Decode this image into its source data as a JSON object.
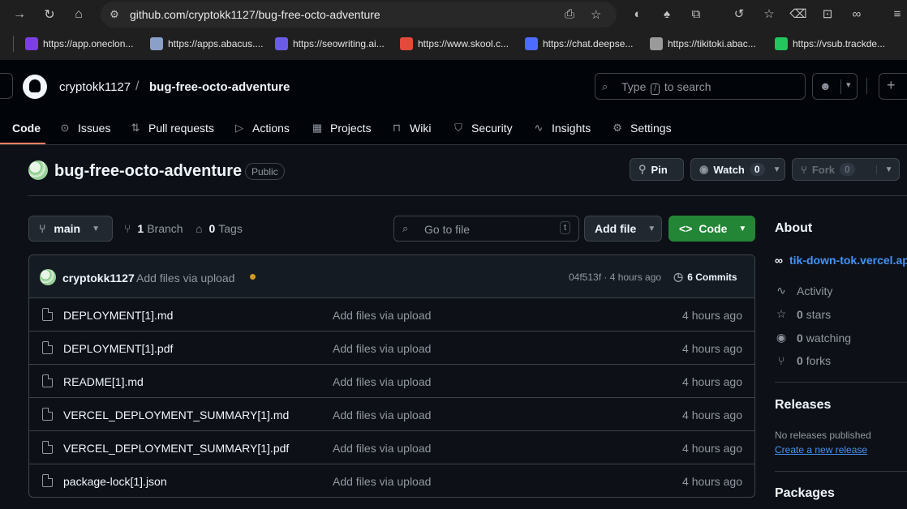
{
  "browser": {
    "url": "github.com/cryptokk1127/bug-free-octo-adventure",
    "bookmarks": [
      {
        "label": "https://app.oneclon...",
        "color": "#7b3fe4"
      },
      {
        "label": "https://apps.abacus....",
        "color": "#8aa0c8"
      },
      {
        "label": "https://seowriting.ai...",
        "color": "#6b5ce7"
      },
      {
        "label": "https://www.skool.c...",
        "color": "#e34a3c"
      },
      {
        "label": "https://chat.deepse...",
        "color": "#4d6bfe"
      },
      {
        "label": "https://tikitoki.abac...",
        "color": "#9a9a9a"
      },
      {
        "label": "https://vsub.trackde...",
        "color": "#22c55e"
      }
    ]
  },
  "header": {
    "owner": "cryptokk1127",
    "separator": "/",
    "repo": "bug-free-octo-adventure",
    "search_before": "Type",
    "search_key": "/",
    "search_after": "to search"
  },
  "tabs": [
    {
      "label": "Code",
      "icon": "code-icon",
      "glyph": "<>"
    },
    {
      "label": "Issues",
      "icon": "issue-icon",
      "glyph": "⊙"
    },
    {
      "label": "Pull requests",
      "icon": "pull-request-icon",
      "glyph": "⇅"
    },
    {
      "label": "Actions",
      "icon": "play-icon",
      "glyph": "▷"
    },
    {
      "label": "Projects",
      "icon": "table-icon",
      "glyph": "▦"
    },
    {
      "label": "Wiki",
      "icon": "book-icon",
      "glyph": "⊓"
    },
    {
      "label": "Security",
      "icon": "shield-icon",
      "glyph": "⛉"
    },
    {
      "label": "Insights",
      "icon": "graph-icon",
      "glyph": "∿"
    },
    {
      "label": "Settings",
      "icon": "gear-icon",
      "glyph": "⚙"
    }
  ],
  "repo_head": {
    "name": "bug-free-octo-adventure",
    "visibility": "Public",
    "pin_label": "Pin",
    "watch_label": "Watch",
    "watch_count": "0",
    "fork_label": "Fork",
    "fork_count": "0"
  },
  "toolbar": {
    "branch": "main",
    "branch_count": "1",
    "branch_label": "Branch",
    "tag_count": "0",
    "tag_label": "Tags",
    "go_to_file": "Go to file",
    "go_to_file_key": "t",
    "add_file": "Add file",
    "code_button": "Code"
  },
  "commit": {
    "author": "cryptokk1127",
    "message": "Add files via upload",
    "meta": "04f513f · 4 hours ago",
    "commits_count": "6",
    "commits_label": "Commits",
    "status_color": "#d29922"
  },
  "files": [
    {
      "name": "DEPLOYMENT[1].md",
      "message": "Add files via upload",
      "time": "4 hours ago"
    },
    {
      "name": "DEPLOYMENT[1].pdf",
      "message": "Add files via upload",
      "time": "4 hours ago"
    },
    {
      "name": "README[1].md",
      "message": "Add files via upload",
      "time": "4 hours ago"
    },
    {
      "name": "VERCEL_DEPLOYMENT_SUMMARY[1].md",
      "message": "Add files via upload",
      "time": "4 hours ago"
    },
    {
      "name": "VERCEL_DEPLOYMENT_SUMMARY[1].pdf",
      "message": "Add files via upload",
      "time": "4 hours ago"
    },
    {
      "name": "package-lock[1].json",
      "message": "Add files via upload",
      "time": "4 hours ago"
    }
  ],
  "about": {
    "title": "About",
    "link": "tik-down-tok.vercel.app",
    "activity": "Activity",
    "stars_count": "0",
    "stars_label": "stars",
    "watching_count": "0",
    "watching_label": "watching",
    "forks_count": "0",
    "forks_label": "forks"
  },
  "releases": {
    "title": "Releases",
    "none": "No releases published",
    "create_link": "Create a new release"
  },
  "packages": {
    "title": "Packages"
  },
  "colors": {
    "accent": "#4493f8",
    "code_button": "#238636",
    "tab_underline": "#f78166"
  }
}
